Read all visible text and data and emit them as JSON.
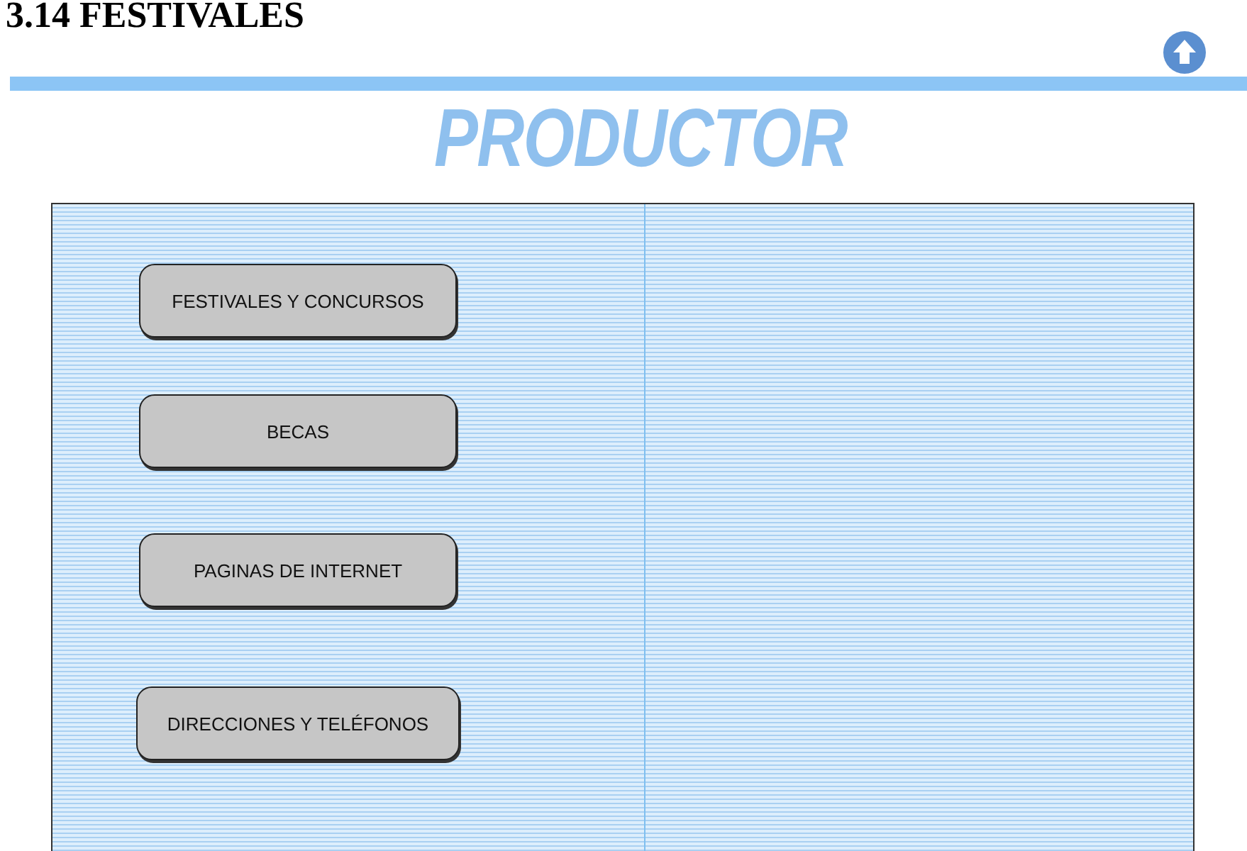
{
  "heading": "3.14 FESTIVALES",
  "banner": {
    "title": "PRODUCTOR"
  },
  "menu": [
    {
      "label": "FESTIVALES Y CONCURSOS"
    },
    {
      "label": "BECAS"
    },
    {
      "label": "PAGINAS DE INTERNET"
    },
    {
      "label": "DIRECCIONES Y TELÉFONOS"
    }
  ]
}
